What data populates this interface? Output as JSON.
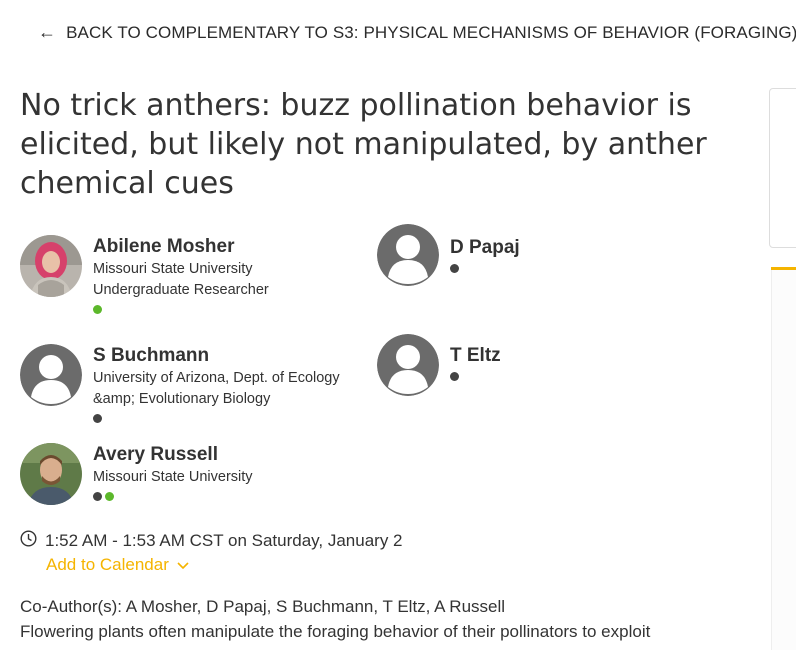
{
  "back_link": {
    "label": "BACK TO COMPLEMENTARY TO S3: PHYSICAL MECHANISMS OF BEHAVIOR (FORAGING)"
  },
  "title": "No trick anthers: buzz pollination behavior is elicited, but likely not manipulated, by anther chemical cues",
  "authors": [
    {
      "name": "Abilene Mosher",
      "affiliation": "Missouri State University",
      "role": "Undergraduate Researcher",
      "avatar": "photo",
      "dots": [
        "#5cb82b"
      ]
    },
    {
      "name": "D Papaj",
      "avatar": "placeholder-person-icon",
      "dots": [
        "#444444"
      ]
    },
    {
      "name": "S Buchmann",
      "affiliation": "University of Arizona, Dept. of Ecology &amp; Evolutionary Biology",
      "avatar": "placeholder-person-icon",
      "dots": [
        "#444444"
      ]
    },
    {
      "name": "T Eltz",
      "avatar": "placeholder-person-icon",
      "dots": [
        "#444444"
      ]
    },
    {
      "name": "Avery Russell",
      "affiliation": "Missouri State University",
      "avatar": "photo",
      "dots": [
        "#444444",
        "#5cb82b"
      ]
    }
  ],
  "session": {
    "time": "1:52 AM - 1:53 AM CST on Saturday, January 2",
    "add_to_calendar": "Add to Calendar",
    "icons": {
      "clock": "clock-icon",
      "chevron": "chevron-down-icon"
    }
  },
  "coauthors": "Co-Author(s): A Mosher, D Papaj, S Buchmann, T Eltz, A Russell",
  "abstract_start": "Flowering plants often manipulate the foraging behavior of their pollinators to exploit",
  "colors": {
    "accent": "#f5b400",
    "presence_online": "#5cb82b",
    "presence_offline": "#444444",
    "avatar_gray": "#6b6b6b"
  }
}
